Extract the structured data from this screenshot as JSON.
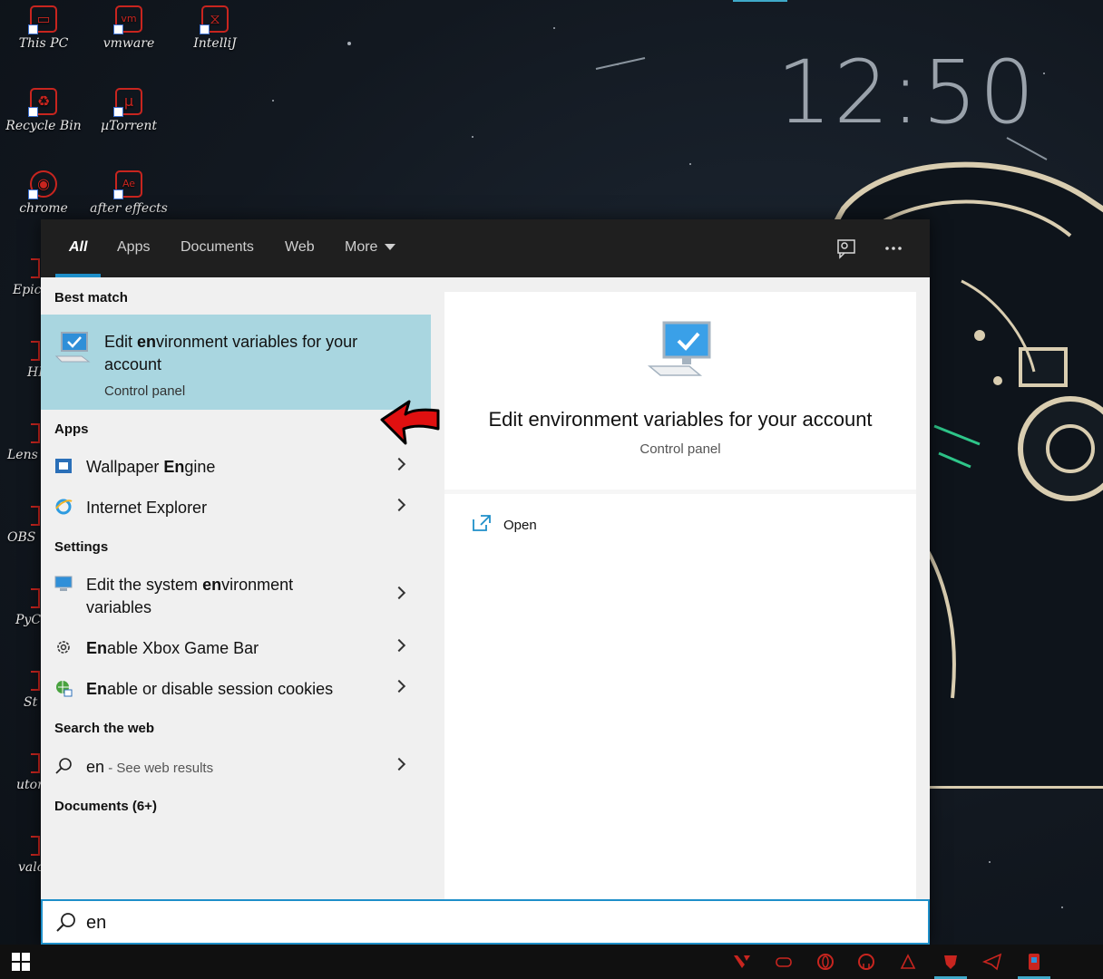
{
  "desktop": {
    "clock": "12:50",
    "icons": [
      {
        "label": "This PC",
        "icon": "monitor-icon"
      },
      {
        "label": "vmware",
        "icon": "vmware-icon"
      },
      {
        "label": "IntelliJ",
        "icon": "intellij-icon"
      },
      {
        "label": "Recycle Bin",
        "icon": "trash-icon"
      },
      {
        "label": "µTorrent",
        "icon": "utorrent-icon"
      },
      {
        "label": "chrome",
        "icon": "chrome-icon"
      },
      {
        "label": "after effects",
        "icon": "after-effects-icon"
      }
    ],
    "edge_labels": [
      "Epic",
      "HI",
      "Lens",
      "OBS",
      "PyC",
      "St",
      "utor",
      "valo"
    ]
  },
  "search": {
    "tabs": [
      "All",
      "Apps",
      "Documents",
      "Web",
      "More"
    ],
    "active_tab": "All",
    "header_icons": [
      "feedback-icon",
      "more-options-icon"
    ],
    "best_match_heading": "Best match",
    "best_match": {
      "title_prefix": "Edit ",
      "title_bold": "en",
      "title_suffix": "vironment variables for your account",
      "subtitle": "Control panel"
    },
    "apps_heading": "Apps",
    "apps": [
      {
        "prefix": "Wallpaper ",
        "bold": "En",
        "suffix": "gine"
      },
      {
        "prefix": "Internet Explorer",
        "bold": "",
        "suffix": ""
      }
    ],
    "settings_heading": "Settings",
    "settings": [
      {
        "prefix": "Edit the system ",
        "bold": "en",
        "suffix": "vironment variables"
      },
      {
        "prefix": "",
        "bold": "En",
        "suffix": "able Xbox Game Bar"
      },
      {
        "prefix": "",
        "bold": "En",
        "suffix": "able or disable session cookies"
      }
    ],
    "web_heading": "Search the web",
    "web_result": {
      "query": "en",
      "suffix": " - See web results"
    },
    "documents_heading": "Documents (6+)",
    "preview": {
      "title": "Edit environment variables for your account",
      "subtitle": "Control panel",
      "action_open": "Open"
    },
    "query": "en"
  },
  "colors": {
    "selection": "#a9d6e0",
    "accent": "#1e8fc9",
    "header_bg": "#1f1f1f",
    "arrow_red": "#e01010"
  }
}
